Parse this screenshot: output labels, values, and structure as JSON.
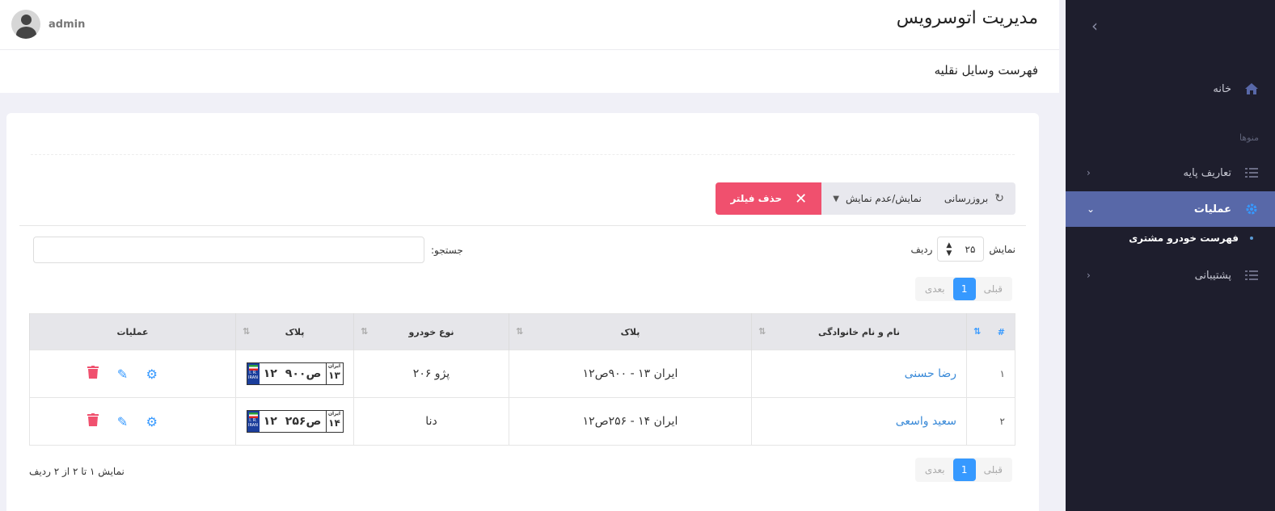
{
  "header": {
    "app_title": "مدیریت اتوسرویس",
    "user_name": "admin"
  },
  "page": {
    "title": "فهرست وسایل نقلیه"
  },
  "sidebar": {
    "home": "خانه",
    "section": "منوها",
    "base_definitions": "تعاریف پایه",
    "operations": "عملیات",
    "sub_customer_cars": "فهرست خودرو مشتری",
    "support": "پشتیبانی"
  },
  "toolbar": {
    "refresh": "بروزرسانی",
    "toggle_columns": "نمایش/عدم نمایش",
    "clear_filter": "حذف فیلتر"
  },
  "length": {
    "prefix": "نمایش",
    "value": "۲۵",
    "suffix": "ردیف"
  },
  "search": {
    "label": "جستجو:",
    "placeholder": ""
  },
  "pager": {
    "prev": "قبلی",
    "page": "1",
    "next": "بعدی"
  },
  "table": {
    "headers": {
      "num": "#",
      "name": "نام و نام خانوادگی",
      "plate": "پلاک",
      "car_type": "نوع خودرو",
      "plate_img": "پلاک",
      "ops": "عملیات"
    },
    "rows": [
      {
        "num": "۱",
        "name": "رضا حسنی",
        "plate_text": "ایران ۱۳ - ۹۰۰ص۱۲",
        "car_type": "پژو ۲۰۶",
        "plate_code": "۹۰۰ص",
        "plate_num": "۱۲",
        "plate_region": "۱۳",
        "plate_region_label": "ایران",
        "plate_ir": "I. R.",
        "plate_iran": "IRAN"
      },
      {
        "num": "۲",
        "name": "سعید واسعی",
        "plate_text": "ایران ۱۴ - ۲۵۶ص۱۲",
        "car_type": "دنا",
        "plate_code": "۲۵۶ص",
        "plate_num": "۱۲",
        "plate_region": "۱۴",
        "plate_region_label": "ایران",
        "plate_ir": "I. R.",
        "plate_iran": "IRAN"
      }
    ]
  },
  "info": "نمایش ۱ تا ۲ از ۲ ردیف",
  "colors": {
    "accent": "#3699ff",
    "danger": "#f0506e",
    "sidebar": "#1e1e2d",
    "sidebar_active": "#5868a8"
  }
}
